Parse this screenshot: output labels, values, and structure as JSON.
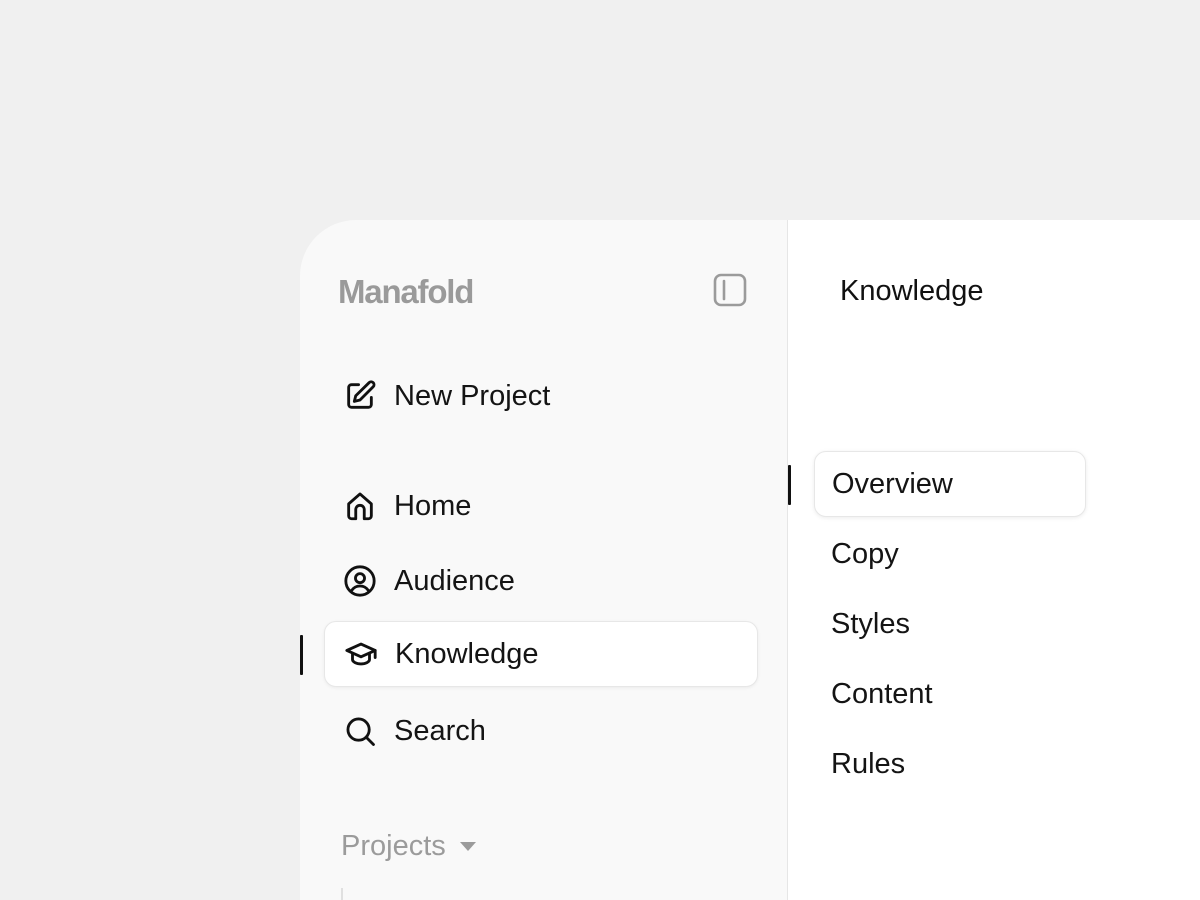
{
  "brand": {
    "name": "Manafold"
  },
  "sidebar": {
    "toggle_icon": "sidebar-panel-icon",
    "new_project": {
      "label": "New Project",
      "icon": "edit-icon"
    },
    "items": [
      {
        "label": "Home",
        "icon": "home-icon",
        "active": false
      },
      {
        "label": "Audience",
        "icon": "user-circle-icon",
        "active": false
      },
      {
        "label": "Knowledge",
        "icon": "graduation-cap-icon",
        "active": true
      },
      {
        "label": "Search",
        "icon": "search-icon",
        "active": false
      }
    ],
    "projects": {
      "label": "Projects",
      "expanded": true
    }
  },
  "content": {
    "title": "Knowledge",
    "sub_items": [
      {
        "label": "Overview",
        "active": true
      },
      {
        "label": "Copy",
        "active": false
      },
      {
        "label": "Styles",
        "active": false
      },
      {
        "label": "Content",
        "active": false
      },
      {
        "label": "Rules",
        "active": false
      }
    ]
  },
  "colors": {
    "page_background": "#f0f0f0",
    "sidebar_background": "#f9f9f9",
    "content_background": "#ffffff",
    "muted_text": "#9a9a9a",
    "primary_text": "#141414",
    "active_marker": "#111111"
  }
}
